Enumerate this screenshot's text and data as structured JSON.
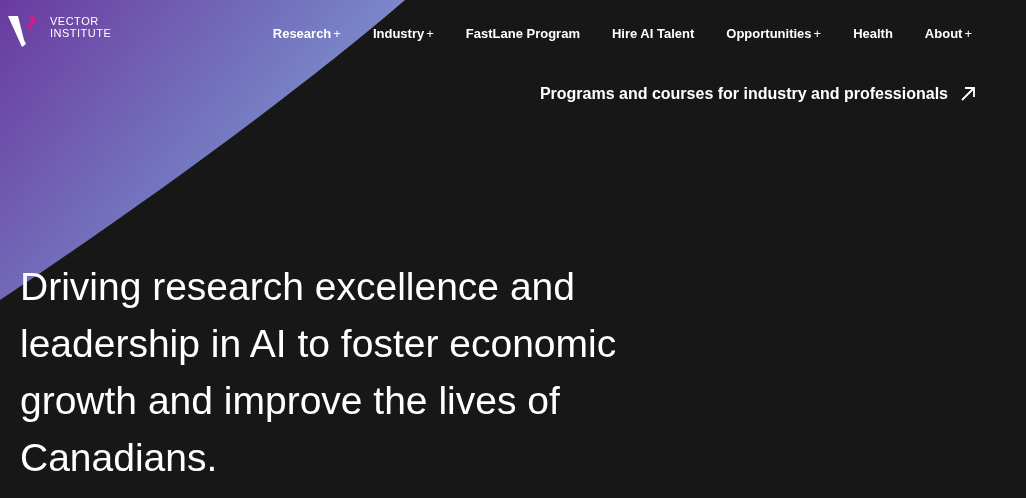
{
  "logo": {
    "lines": [
      "VECTOR",
      "INSTITUTE"
    ]
  },
  "nav": [
    {
      "label": "Research",
      "suffix": "+"
    },
    {
      "label": "Industry",
      "suffix": "+"
    },
    {
      "label": "FastLane Program"
    },
    {
      "label": "Hire AI Talent"
    },
    {
      "label": "Opportunities",
      "suffix": "+"
    },
    {
      "label": "Health"
    },
    {
      "label": "About",
      "suffix": "+"
    }
  ],
  "secondary_link": {
    "label": "Programs and courses for industry and professionals"
  },
  "hero": {
    "heading_lines": [
      "Driving research excellence and",
      "leadership in AI to foster economic",
      "growth and improve the lives of",
      "Canadians."
    ]
  }
}
